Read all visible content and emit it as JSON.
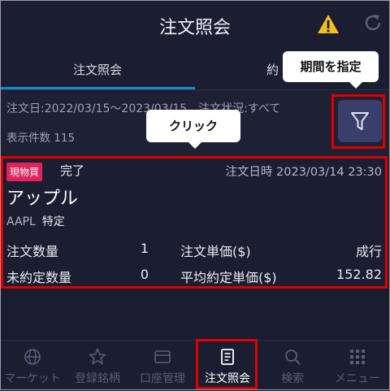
{
  "header": {
    "title": "注文照会"
  },
  "tabs": [
    {
      "label": "注文照会"
    },
    {
      "label": "約"
    }
  ],
  "filter": {
    "line1": "注文日:2022/03/15～2023/03/15　注文状況:すべて",
    "line2": "表示件数 115"
  },
  "tooltips": {
    "filter": "期間を指定",
    "card": "クリック"
  },
  "order": {
    "badge": "現物買",
    "status": "完了",
    "datetime": "注文日時 2023/03/14 23:30",
    "name": "アップル",
    "symbol": "AAPL",
    "account": "特定",
    "qty_label": "注文数量",
    "qty": "1",
    "price_label": "注文単価($)",
    "price": "成行",
    "unfilled_label": "未約定数量",
    "unfilled": "0",
    "avg_label": "平均約定単価($)",
    "avg": "152.82"
  },
  "nav": [
    {
      "label": "マーケット",
      "icon": "globe-icon"
    },
    {
      "label": "登録銘柄",
      "icon": "star-icon"
    },
    {
      "label": "口座管理",
      "icon": "card-icon"
    },
    {
      "label": "注文照会",
      "icon": "document-icon"
    },
    {
      "label": "検索",
      "icon": "search-icon"
    },
    {
      "label": "メニュー",
      "icon": "grid-icon"
    }
  ],
  "colors": {
    "accent": "#0e8fd0",
    "highlight": "#e00000",
    "badge": "#e0225c",
    "background": "#1a1c30"
  }
}
